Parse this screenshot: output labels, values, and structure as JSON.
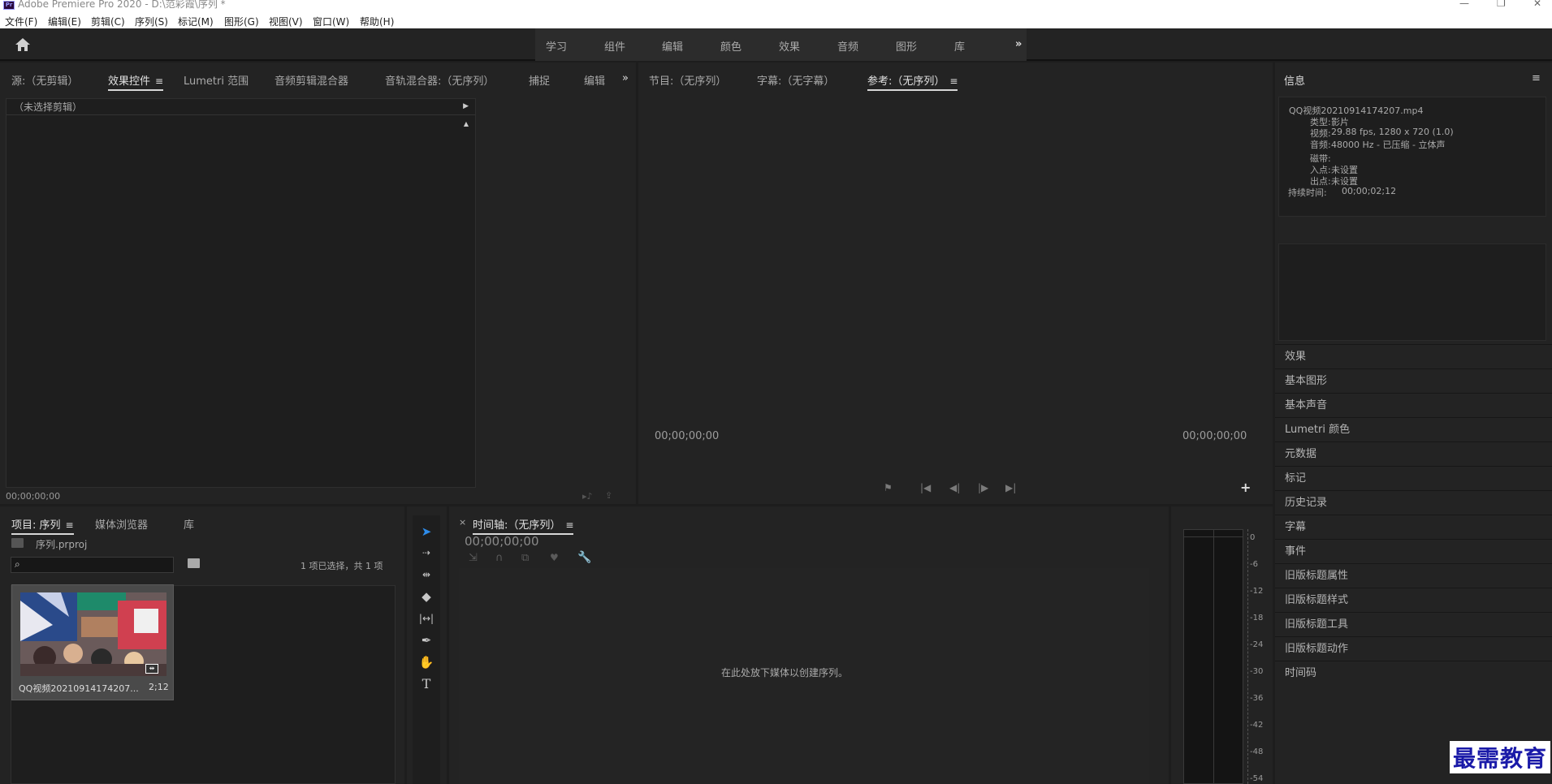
{
  "window": {
    "title": "Adobe Premiere Pro 2020 - D:\\范彩霞\\序列 *",
    "app_icon": "Pr"
  },
  "menu": [
    "文件(F)",
    "编辑(E)",
    "剪辑(C)",
    "序列(S)",
    "标记(M)",
    "图形(G)",
    "视图(V)",
    "窗口(W)",
    "帮助(H)"
  ],
  "workspaces": [
    "学习",
    "组件",
    "编辑",
    "颜色",
    "效果",
    "音频",
    "图形",
    "库"
  ],
  "source_panel": {
    "tabs": [
      "源:（无剪辑）",
      "效果控件",
      "Lumetri 范围",
      "音频剪辑混合器",
      "音轨混合器:（无序列）",
      "捕捉",
      "编辑"
    ],
    "active_tab": "效果控件",
    "clip_header": "（未选择剪辑）",
    "timecode": "00;00;00;00"
  },
  "program_panel": {
    "tabs": [
      "节目:（无序列）",
      "字幕:（无字幕）",
      "参考:（无序列）"
    ],
    "active_tab": "参考:（无序列）",
    "timecode_left": "00;00;00;00",
    "timecode_right": "00;00;00;00"
  },
  "info_panel": {
    "title": "信息",
    "file": "QQ视频20210914174207.mp4",
    "type_label": "类型:",
    "type_value": "影片",
    "video_label": "视频:",
    "video_value": "29.88 fps, 1280 x 720 (1.0)",
    "audio_label": "音频:",
    "audio_value": "48000 Hz - 已压缩 - 立体声",
    "tape_label": "磁带:",
    "in_label": "入点:",
    "in_value": "未设置",
    "out_label": "出点:",
    "out_value": "未设置",
    "duration_label": "持续时间:",
    "duration_value": "00;00;02;12"
  },
  "side_panels": [
    "效果",
    "基本图形",
    "基本声音",
    "Lumetri 颜色",
    "元数据",
    "标记",
    "历史记录",
    "字幕",
    "事件",
    "旧版标题属性",
    "旧版标题样式",
    "旧版标题工具",
    "旧版标题动作",
    "时间码"
  ],
  "project_panel": {
    "tabs": [
      "项目: 序列",
      "媒体浏览器",
      "库"
    ],
    "active_tab": "项目: 序列",
    "project_file": "序列.prproj",
    "selection_status": "1 项已选择，共 1 项",
    "item_name": "QQ视频20210914174207...",
    "item_duration": "2;12"
  },
  "timeline_panel": {
    "title": "时间轴:（无序列）",
    "timecode": "00;00;00;00",
    "drop_hint": "在此处放下媒体以创建序列。"
  },
  "meter": {
    "db_labels": [
      "0",
      "-6",
      "-12",
      "-18",
      "-24",
      "-30",
      "-36",
      "-42",
      "-48",
      "-54"
    ]
  },
  "watermark": "最需教育",
  "colors": {
    "panel_bg": "#232323",
    "frame_bg": "#1d1d1d",
    "accent_blue": "#2d8ceb",
    "text": "#b8b8b8"
  }
}
